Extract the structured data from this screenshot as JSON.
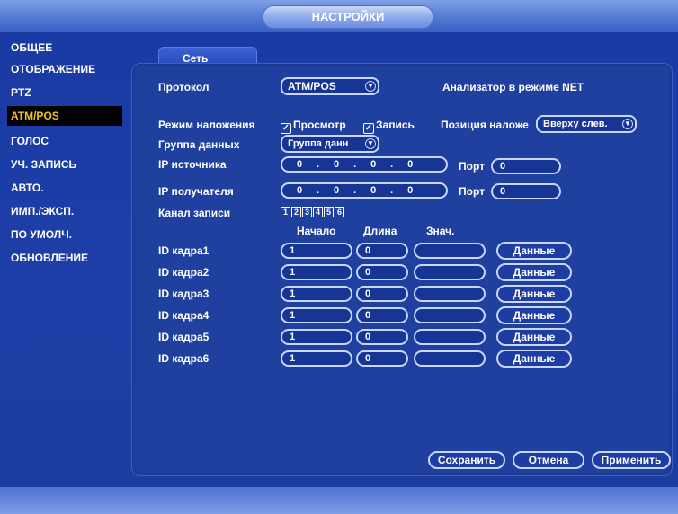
{
  "window": {
    "title": "НАСТРОЙКИ"
  },
  "sidebar": {
    "items": [
      {
        "label": "ОБЩЕЕ",
        "active": false
      },
      {
        "label": "ОТОБРАЖЕНИЕ",
        "active": false
      },
      {
        "label": "PTZ",
        "active": false
      },
      {
        "label": "ATM/POS",
        "active": true
      },
      {
        "label": "ГОЛОС",
        "active": false
      },
      {
        "label": "УЧ. ЗАПИСЬ",
        "active": false
      },
      {
        "label": "АВТО.",
        "active": false
      },
      {
        "label": "ИМП./ЭКСП.",
        "active": false
      },
      {
        "label": "ПО УМОЛЧ.",
        "active": false
      },
      {
        "label": "ОБНОВЛЕНИЕ",
        "active": false
      }
    ]
  },
  "tabs": {
    "active": "Сеть"
  },
  "form": {
    "protocol_label": "Протокол",
    "protocol_value": "ATM/POS",
    "analyzer_text": "Анализатор в режиме NET",
    "overlay_mode_label": "Режим наложения",
    "preview_label": "Просмотр",
    "preview_checked": true,
    "record_label": "Запись",
    "record_checked": true,
    "overlay_position_label": "Позиция наложе",
    "overlay_position_value": "Вверху слев.",
    "data_group_label": "Группа данных",
    "data_group_value": "Группа данн",
    "source_ip_label": "IP источника",
    "source_ip": [
      "0",
      "0",
      "0",
      "0"
    ],
    "source_port_label": "Порт",
    "source_port": "0",
    "dest_ip_label": "IP получателя",
    "dest_ip": [
      "0",
      "0",
      "0",
      "0"
    ],
    "dest_port_label": "Порт",
    "dest_port": "0",
    "record_channel_label": "Канал записи",
    "channels": [
      "1",
      "2",
      "3",
      "4",
      "5",
      "6"
    ],
    "columns": {
      "start": "Начало",
      "length": "Длина",
      "value": "Знач."
    },
    "frames": [
      {
        "label": "ID кадра1",
        "start": "1",
        "length": "0",
        "value": "",
        "button": "Данные"
      },
      {
        "label": "ID кадра2",
        "start": "1",
        "length": "0",
        "value": "",
        "button": "Данные"
      },
      {
        "label": "ID кадра3",
        "start": "1",
        "length": "0",
        "value": "",
        "button": "Данные"
      },
      {
        "label": "ID кадра4",
        "start": "1",
        "length": "0",
        "value": "",
        "button": "Данные"
      },
      {
        "label": "ID кадра5",
        "start": "1",
        "length": "0",
        "value": "",
        "button": "Данные"
      },
      {
        "label": "ID кадра6",
        "start": "1",
        "length": "0",
        "value": "",
        "button": "Данные"
      }
    ]
  },
  "footer": {
    "save": "Сохранить",
    "cancel": "Отмена",
    "apply": "Применить"
  },
  "colors": {
    "background": "#1e3fa8",
    "active_item_text": "#f2c21a",
    "active_item_bg": "#000000"
  }
}
